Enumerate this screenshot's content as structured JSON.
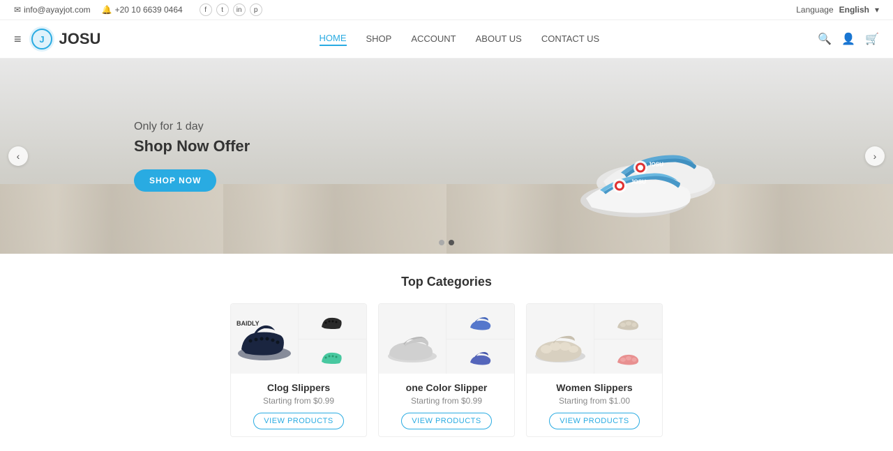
{
  "topbar": {
    "email": "info@ayayjot.com",
    "phone": "+20 10 6639 0464",
    "language_label": "Language",
    "language_value": "English",
    "social": [
      "f",
      "t",
      "in",
      "p"
    ]
  },
  "header": {
    "logo_text": "JOSU",
    "hamburger_icon": "≡",
    "nav": [
      {
        "label": "HOME",
        "active": true
      },
      {
        "label": "SHOP",
        "active": false
      },
      {
        "label": "ACCOUNT",
        "active": false
      },
      {
        "label": "ABOUT US",
        "active": false
      },
      {
        "label": "CONTACT US",
        "active": false
      }
    ],
    "search_icon": "🔍",
    "account_icon": "👤",
    "cart_icon": "🛒"
  },
  "hero": {
    "subtitle": "Only for 1 day",
    "title": "Shop Now Offer",
    "button_label": "SHOP NOW",
    "prev_arrow": "‹",
    "next_arrow": "›",
    "dots": [
      false,
      true
    ]
  },
  "categories": {
    "section_title": "Top Categories",
    "items": [
      {
        "name": "Clog Slippers",
        "price_text": "Starting from $0.99",
        "button_label": "VIEW PRODUCTS",
        "brand": "BAIDLY"
      },
      {
        "name": "one Color Slipper",
        "price_text": "Starting from $0.99",
        "button_label": "VIEW PRODUCTS",
        "brand": ""
      },
      {
        "name": "Women Slippers",
        "price_text": "Starting from $1.00",
        "button_label": "VIEW PRODUCTS",
        "brand": ""
      }
    ]
  }
}
